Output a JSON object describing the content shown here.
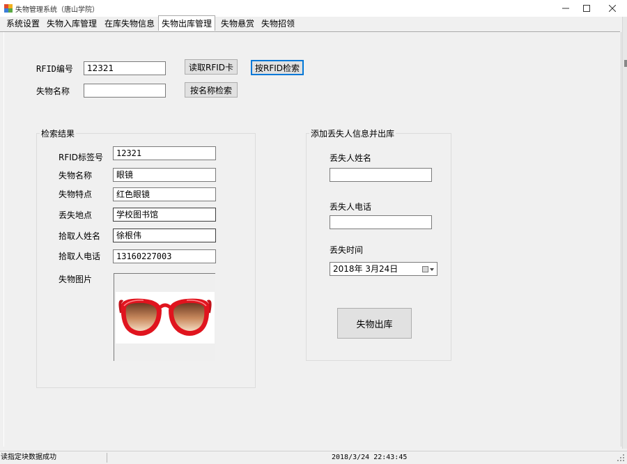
{
  "window": {
    "title": "失物管理系统（唐山学院）",
    "controls": {
      "minimize": "—",
      "maximize": "☐",
      "close": "✕"
    }
  },
  "tabs": [
    "系统设置",
    "失物入库管理",
    "在库失物信息",
    "失物出库管理",
    "失物悬赏",
    "失物招领"
  ],
  "active_tab_index": 3,
  "search": {
    "rfid_label": "RFID编号",
    "rfid_value": "12321",
    "read_card_button": "读取RFID卡",
    "search_rfid_button": "按RFID检索",
    "name_label": "失物名称",
    "name_value": "",
    "search_name_button": "按名称检索"
  },
  "results": {
    "title": "检索结果",
    "fields": [
      {
        "label": "RFID标签号",
        "value": "12321"
      },
      {
        "label": "失物名称",
        "value": "眼镜"
      },
      {
        "label": "失物特点",
        "value": "红色眼镜"
      },
      {
        "label": "丢失地点",
        "value": "学校图书馆"
      },
      {
        "label": "拾取人姓名",
        "value": "徐根伟"
      },
      {
        "label": "拾取人电话",
        "value": "13160227003"
      }
    ],
    "image_label": "失物图片"
  },
  "checkout": {
    "title": "添加丢失人信息并出库",
    "owner_name_label": "丢失人姓名",
    "owner_name_value": "",
    "owner_phone_label": "丢失人电话",
    "owner_phone_value": "",
    "lost_time_label": "丢失时间",
    "lost_time_value": "2018年  3月24日",
    "checkout_button": "失物出库"
  },
  "status": {
    "message": "读指定块数据成功",
    "datetime": "2018/3/24 22:43:45"
  },
  "colors": {
    "background": "#f0f0f0",
    "focus_border": "#0078d7",
    "glasses_frame": "#e0141e"
  }
}
